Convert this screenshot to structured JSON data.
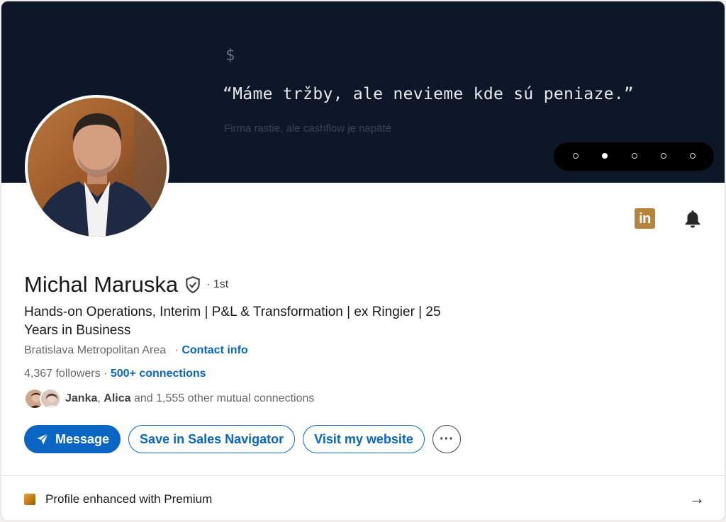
{
  "banner": {
    "prompt": "$",
    "quote": "“Máme tržby, ale nevieme kde sú peniaze.”",
    "subtext": "Firma rastie, ale cashflow je napäté",
    "carousel_active_index": 1,
    "carousel_total": 5
  },
  "profile": {
    "name": "Michal Maruska",
    "degree": "· 1st",
    "headline": "Hands-on Operations, Interim | P&L & Transformation | ex Ringier | 25 Years in Business",
    "location": "Bratislava Metropolitan Area",
    "contact_separator": "·",
    "contact_label": "Contact info",
    "followers": "4,367 followers",
    "followers_separator": "·",
    "connections": "500+ connections",
    "mutual_name_1": "Janka",
    "mutual_name_2": "Alica",
    "mutual_and": "and",
    "mutual_rest": "1,555 other mutual connections"
  },
  "actions": {
    "message": "Message",
    "sales_navigator": "Save in Sales Navigator",
    "website": "Visit my website",
    "more": "···"
  },
  "top_icons": {
    "linkedin_label": "in",
    "linkedin_icon": "linkedin-icon",
    "bell_icon": "bell-icon"
  },
  "premium": {
    "label": "Profile enhanced with Premium",
    "arrow": "→"
  },
  "colors": {
    "banner_bg": "#0d1728",
    "accent": "#0a66c2",
    "premium_gold": "#b8843c"
  }
}
